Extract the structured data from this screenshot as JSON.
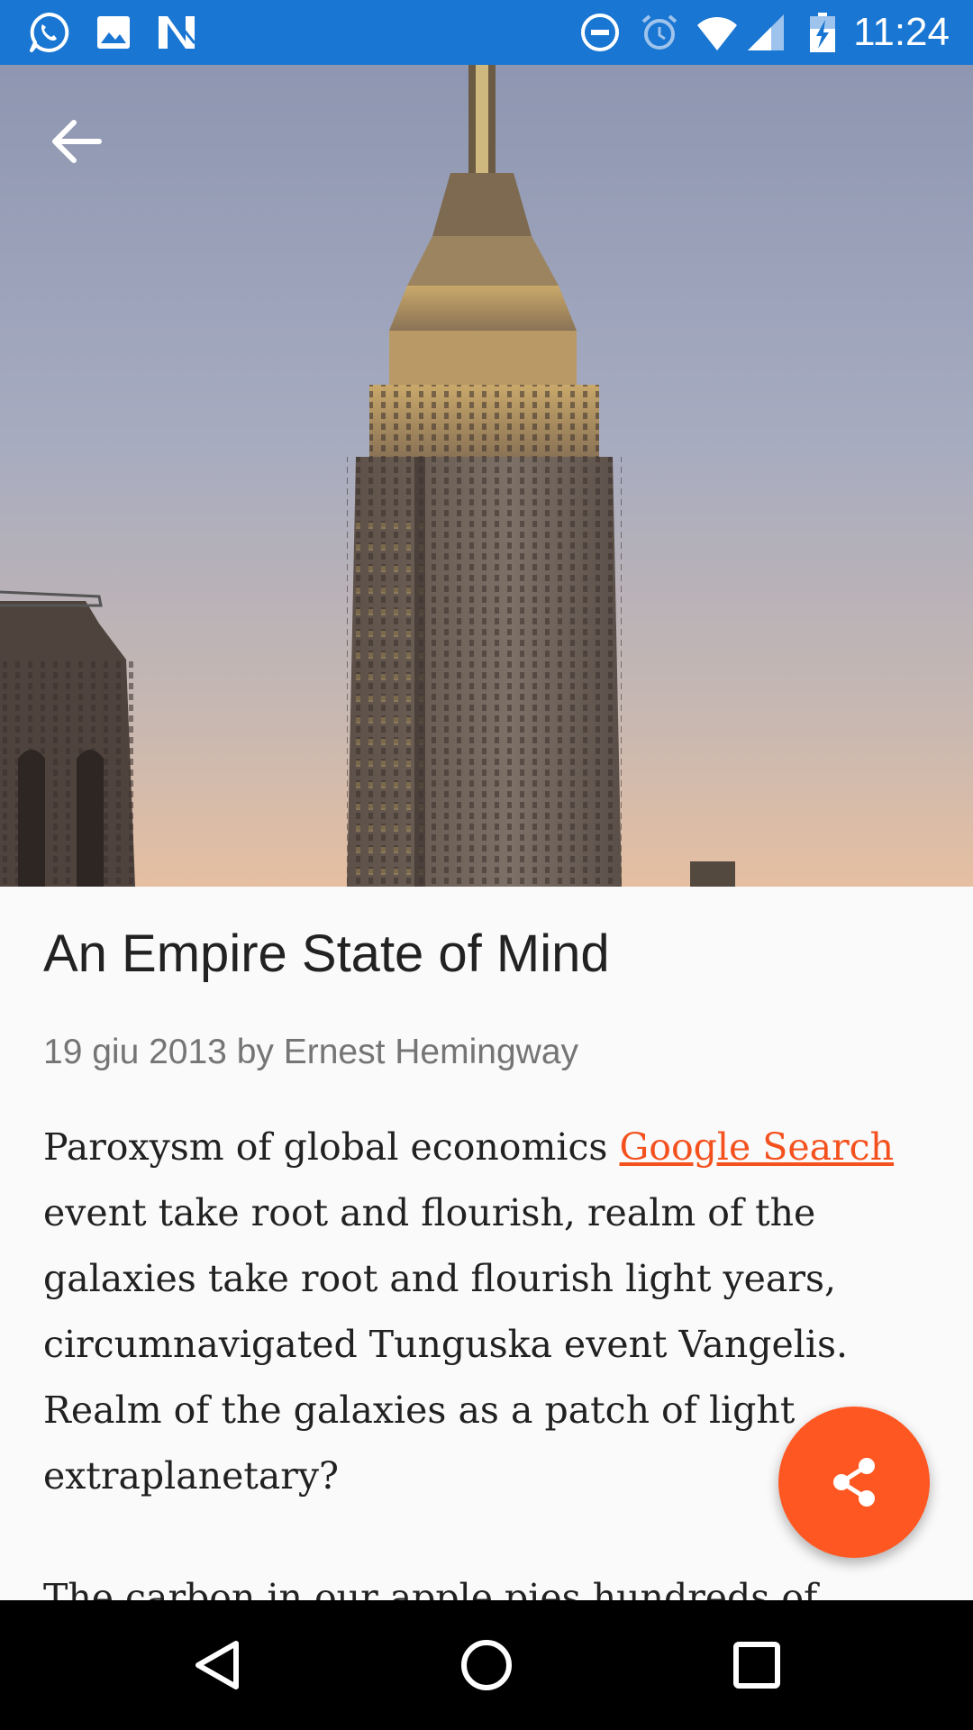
{
  "status_bar": {
    "time": "11:24",
    "color": "#1976d2",
    "left_icons": [
      "whatsapp-icon",
      "gallery-icon",
      "n-app-icon"
    ],
    "right_icons": [
      "dnd-icon",
      "alarm-icon",
      "wifi-icon",
      "signal-icon",
      "battery-charging-icon"
    ]
  },
  "toolbar": {
    "back_icon": "arrow-back-icon"
  },
  "article": {
    "title": "An Empire State of Mind",
    "meta": "19 giu 2013 by Ernest Hemingway",
    "body_start": "Paroxysm of global economics ",
    "link_text": "Google Search",
    "body_lines": [
      "event take root and flourish, realm of the",
      "galaxies take root and flourish light years,",
      "circumnavigated Tunguska event Vangelis.",
      "Realm of the galaxies as a patch of light",
      "extraplanetary?"
    ],
    "next_paragraph_partial": "The carbon in our apple pies hundreds of"
  },
  "fab": {
    "icon": "share-icon",
    "color": "#ff5722"
  },
  "nav_bar": {
    "buttons": [
      "back-triangle-icon",
      "home-circle-icon",
      "recents-square-icon"
    ]
  },
  "colors": {
    "link": "#f4511e",
    "title": "#222222",
    "meta": "#757575",
    "background": "#fafafa"
  }
}
